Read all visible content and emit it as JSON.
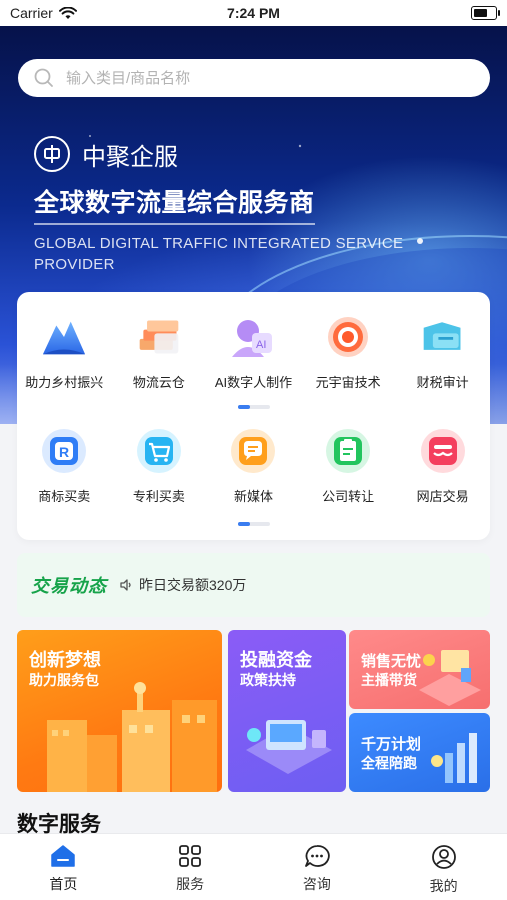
{
  "status_bar": {
    "carrier": "Carrier",
    "time": "7:24 PM"
  },
  "search": {
    "placeholder": "输入类目/商品名称"
  },
  "hero": {
    "brand": "中聚企服",
    "headline": "全球数字流量综合服务商",
    "subline": "GLOBAL DIGITAL TRAFFIC INTEGRATED SERVICE PROVIDER"
  },
  "categories": {
    "row1": [
      {
        "label": "助力乡村振兴",
        "icon": "mountain-icon"
      },
      {
        "label": "物流云仓",
        "icon": "boxes-icon"
      },
      {
        "label": "AI数字人制作",
        "icon": "ai-avatar-icon"
      },
      {
        "label": "元宇宙技术",
        "icon": "target-icon"
      },
      {
        "label": "财税审计",
        "icon": "finance-icon"
      }
    ],
    "row2": [
      {
        "label": "商标买卖",
        "icon": "trademark-icon"
      },
      {
        "label": "专利买卖",
        "icon": "patent-cart-icon"
      },
      {
        "label": "新媒体",
        "icon": "chat-bubble-icon"
      },
      {
        "label": "公司转让",
        "icon": "clipboard-icon"
      },
      {
        "label": "网店交易",
        "icon": "shop-icon"
      }
    ]
  },
  "deal": {
    "title": "交易动态",
    "text": "昨日交易额320万"
  },
  "promos": [
    {
      "title": "创新梦想",
      "subtitle": "助力服务包"
    },
    {
      "title": "投融资金",
      "subtitle": "政策扶持"
    },
    {
      "title": "销售无忧",
      "subtitle": "主播带货"
    },
    {
      "title": "千万计划",
      "subtitle": "全程陪跑"
    }
  ],
  "section": {
    "title": "数字服务"
  },
  "tabbar": [
    {
      "label": "首页",
      "icon": "home-icon"
    },
    {
      "label": "服务",
      "icon": "grid-icon"
    },
    {
      "label": "咨询",
      "icon": "message-icon"
    },
    {
      "label": "我的",
      "icon": "user-icon"
    }
  ],
  "colors": {
    "accent": "#1f6fe8",
    "deal_green": "#16a34a",
    "orange": "#ff8a14",
    "purple": "#7c5cf4",
    "coral": "#f87171",
    "blue": "#2f7af0"
  }
}
